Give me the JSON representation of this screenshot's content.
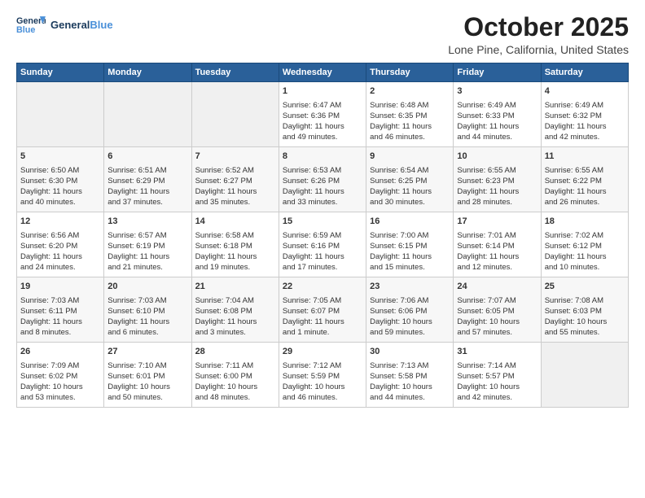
{
  "header": {
    "logo_general": "General",
    "logo_blue": "Blue",
    "month": "October 2025",
    "location": "Lone Pine, California, United States"
  },
  "days_of_week": [
    "Sunday",
    "Monday",
    "Tuesday",
    "Wednesday",
    "Thursday",
    "Friday",
    "Saturday"
  ],
  "weeks": [
    [
      {
        "day": "",
        "content": ""
      },
      {
        "day": "",
        "content": ""
      },
      {
        "day": "",
        "content": ""
      },
      {
        "day": "1",
        "content": "Sunrise: 6:47 AM\nSunset: 6:36 PM\nDaylight: 11 hours\nand 49 minutes."
      },
      {
        "day": "2",
        "content": "Sunrise: 6:48 AM\nSunset: 6:35 PM\nDaylight: 11 hours\nand 46 minutes."
      },
      {
        "day": "3",
        "content": "Sunrise: 6:49 AM\nSunset: 6:33 PM\nDaylight: 11 hours\nand 44 minutes."
      },
      {
        "day": "4",
        "content": "Sunrise: 6:49 AM\nSunset: 6:32 PM\nDaylight: 11 hours\nand 42 minutes."
      }
    ],
    [
      {
        "day": "5",
        "content": "Sunrise: 6:50 AM\nSunset: 6:30 PM\nDaylight: 11 hours\nand 40 minutes."
      },
      {
        "day": "6",
        "content": "Sunrise: 6:51 AM\nSunset: 6:29 PM\nDaylight: 11 hours\nand 37 minutes."
      },
      {
        "day": "7",
        "content": "Sunrise: 6:52 AM\nSunset: 6:27 PM\nDaylight: 11 hours\nand 35 minutes."
      },
      {
        "day": "8",
        "content": "Sunrise: 6:53 AM\nSunset: 6:26 PM\nDaylight: 11 hours\nand 33 minutes."
      },
      {
        "day": "9",
        "content": "Sunrise: 6:54 AM\nSunset: 6:25 PM\nDaylight: 11 hours\nand 30 minutes."
      },
      {
        "day": "10",
        "content": "Sunrise: 6:55 AM\nSunset: 6:23 PM\nDaylight: 11 hours\nand 28 minutes."
      },
      {
        "day": "11",
        "content": "Sunrise: 6:55 AM\nSunset: 6:22 PM\nDaylight: 11 hours\nand 26 minutes."
      }
    ],
    [
      {
        "day": "12",
        "content": "Sunrise: 6:56 AM\nSunset: 6:20 PM\nDaylight: 11 hours\nand 24 minutes."
      },
      {
        "day": "13",
        "content": "Sunrise: 6:57 AM\nSunset: 6:19 PM\nDaylight: 11 hours\nand 21 minutes."
      },
      {
        "day": "14",
        "content": "Sunrise: 6:58 AM\nSunset: 6:18 PM\nDaylight: 11 hours\nand 19 minutes."
      },
      {
        "day": "15",
        "content": "Sunrise: 6:59 AM\nSunset: 6:16 PM\nDaylight: 11 hours\nand 17 minutes."
      },
      {
        "day": "16",
        "content": "Sunrise: 7:00 AM\nSunset: 6:15 PM\nDaylight: 11 hours\nand 15 minutes."
      },
      {
        "day": "17",
        "content": "Sunrise: 7:01 AM\nSunset: 6:14 PM\nDaylight: 11 hours\nand 12 minutes."
      },
      {
        "day": "18",
        "content": "Sunrise: 7:02 AM\nSunset: 6:12 PM\nDaylight: 11 hours\nand 10 minutes."
      }
    ],
    [
      {
        "day": "19",
        "content": "Sunrise: 7:03 AM\nSunset: 6:11 PM\nDaylight: 11 hours\nand 8 minutes."
      },
      {
        "day": "20",
        "content": "Sunrise: 7:03 AM\nSunset: 6:10 PM\nDaylight: 11 hours\nand 6 minutes."
      },
      {
        "day": "21",
        "content": "Sunrise: 7:04 AM\nSunset: 6:08 PM\nDaylight: 11 hours\nand 3 minutes."
      },
      {
        "day": "22",
        "content": "Sunrise: 7:05 AM\nSunset: 6:07 PM\nDaylight: 11 hours\nand 1 minute."
      },
      {
        "day": "23",
        "content": "Sunrise: 7:06 AM\nSunset: 6:06 PM\nDaylight: 10 hours\nand 59 minutes."
      },
      {
        "day": "24",
        "content": "Sunrise: 7:07 AM\nSunset: 6:05 PM\nDaylight: 10 hours\nand 57 minutes."
      },
      {
        "day": "25",
        "content": "Sunrise: 7:08 AM\nSunset: 6:03 PM\nDaylight: 10 hours\nand 55 minutes."
      }
    ],
    [
      {
        "day": "26",
        "content": "Sunrise: 7:09 AM\nSunset: 6:02 PM\nDaylight: 10 hours\nand 53 minutes."
      },
      {
        "day": "27",
        "content": "Sunrise: 7:10 AM\nSunset: 6:01 PM\nDaylight: 10 hours\nand 50 minutes."
      },
      {
        "day": "28",
        "content": "Sunrise: 7:11 AM\nSunset: 6:00 PM\nDaylight: 10 hours\nand 48 minutes."
      },
      {
        "day": "29",
        "content": "Sunrise: 7:12 AM\nSunset: 5:59 PM\nDaylight: 10 hours\nand 46 minutes."
      },
      {
        "day": "30",
        "content": "Sunrise: 7:13 AM\nSunset: 5:58 PM\nDaylight: 10 hours\nand 44 minutes."
      },
      {
        "day": "31",
        "content": "Sunrise: 7:14 AM\nSunset: 5:57 PM\nDaylight: 10 hours\nand 42 minutes."
      },
      {
        "day": "",
        "content": ""
      }
    ]
  ]
}
